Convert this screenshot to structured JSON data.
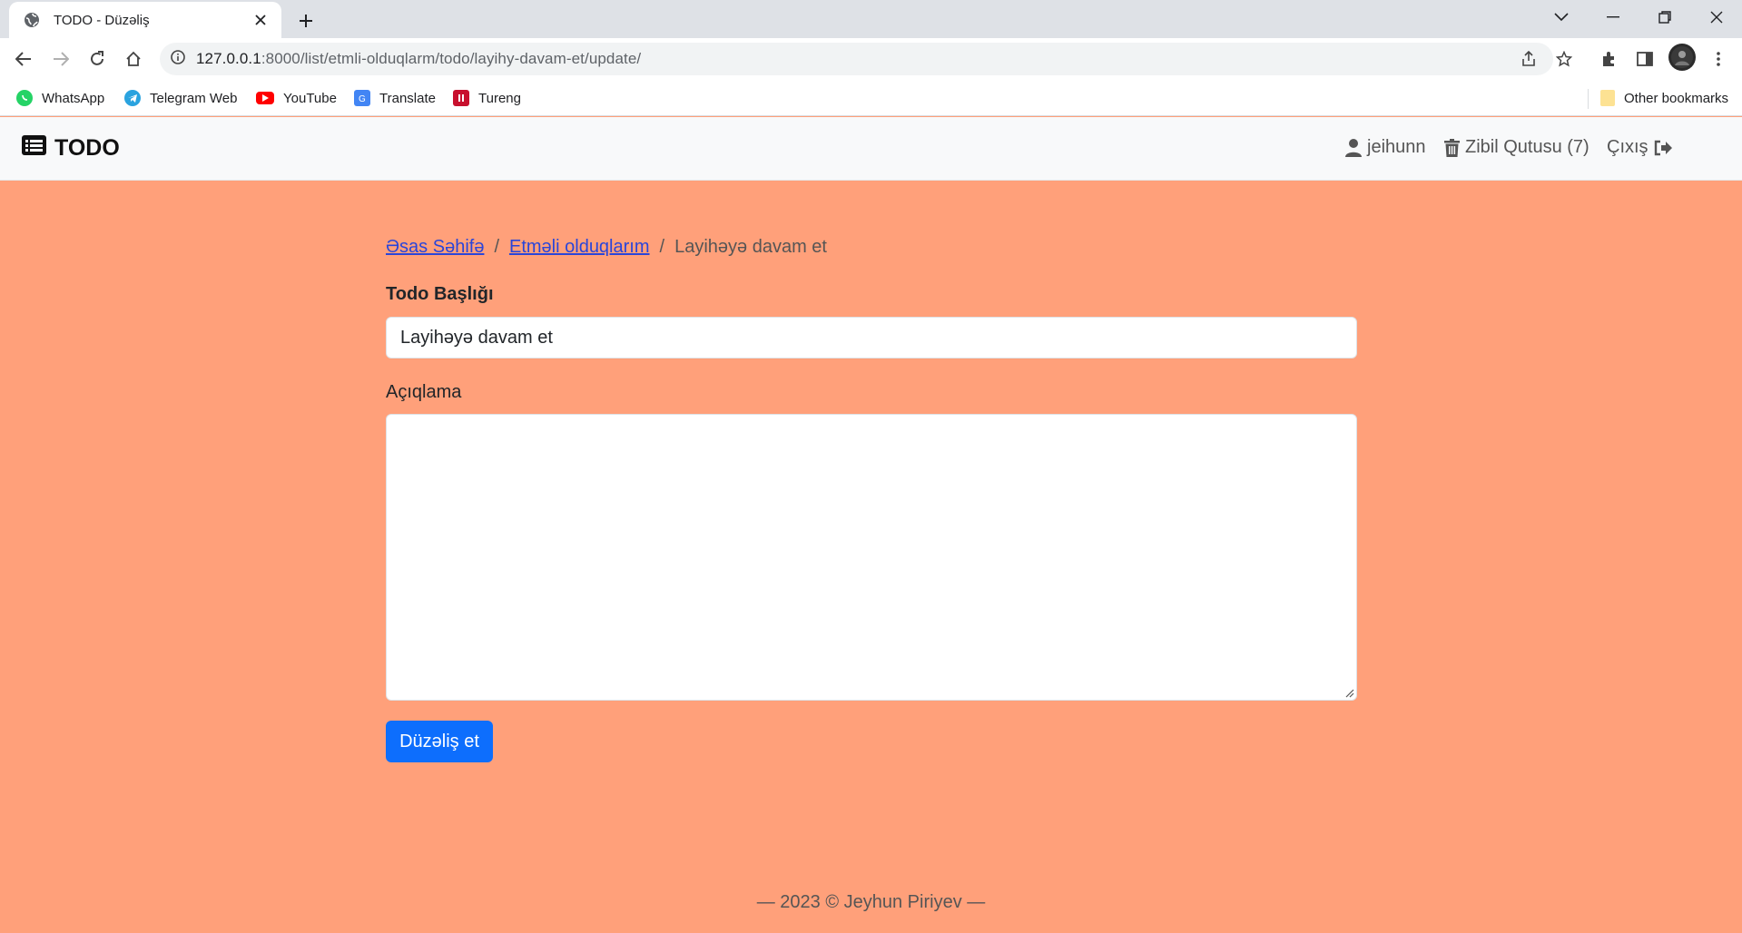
{
  "browser": {
    "tab_title": "TODO - Düzəliş",
    "url_host": "127.0.0.1",
    "url_rest": ":8000/list/etmli-olduqlarm/todo/layihy-davam-et/update/",
    "bookmarks": [
      {
        "label": "WhatsApp",
        "icon": "whatsapp-icon",
        "color": "#25d366"
      },
      {
        "label": "Telegram Web",
        "icon": "telegram-icon",
        "color": "#2aa3df"
      },
      {
        "label": "YouTube",
        "icon": "youtube-icon",
        "color": "#ff0000"
      },
      {
        "label": "Translate",
        "icon": "translate-icon",
        "color": "#4285f4"
      },
      {
        "label": "Tureng",
        "icon": "tureng-icon",
        "color": "#c8102e"
      }
    ],
    "other_bookmarks": "Other bookmarks"
  },
  "navbar": {
    "brand": "TODO",
    "user": "jeihunn",
    "trash": "Zibil Qutusu (7)",
    "logout": "Çıxış"
  },
  "breadcrumb": {
    "home": "Əsas Səhifə",
    "list": "Etməli olduqlarım",
    "current": "Layihəyə davam et",
    "separator": "/"
  },
  "form": {
    "title_label": "Todo Başlığı",
    "title_value": "Layihəyə davam et",
    "description_label": "Açıqlama",
    "description_value": "",
    "submit_label": "Düzəliş et"
  },
  "footer": {
    "text": "— 2023 © Jeyhun Piriyev —"
  },
  "colors": {
    "page_bg": "#ffa07a",
    "primary_button": "#0d6efd",
    "link": "#2a45d9"
  }
}
